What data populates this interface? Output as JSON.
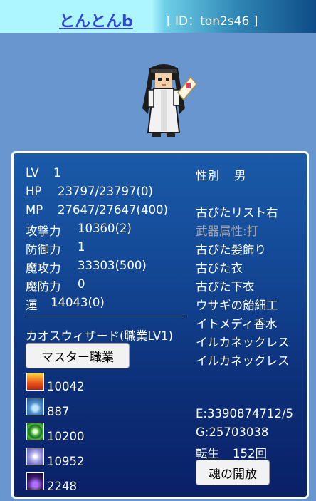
{
  "header": {
    "player_name": "とんとんb",
    "player_id": "[ ID：ton2s46 ]"
  },
  "stats": [
    {
      "label": "LV",
      "value": "1"
    },
    {
      "label": "HP",
      "value": "23797/23797(0)"
    },
    {
      "label": "MP",
      "value": "27647/27647(400)"
    },
    {
      "label": "攻撃力",
      "value": "10360(2)"
    },
    {
      "label": "防御力",
      "value": "1"
    },
    {
      "label": "魔攻力",
      "value": "33303(500)"
    },
    {
      "label": "魔防力",
      "value": "0"
    },
    {
      "label": "運",
      "value": "14043(0)"
    }
  ],
  "profile": {
    "gender_label": "性別",
    "gender_value": "男"
  },
  "equipment": [
    "古びたリスト右",
    "武器属性:打",
    "古びた髪飾り",
    "古びた衣",
    "古びた下衣",
    "ウサギの飴細工",
    "イトメディ香水",
    "イルカネックレス",
    "イルカネックレス"
  ],
  "job": {
    "title": "カオスウィザード(職業LV1)",
    "master_button": "マスター職業"
  },
  "elements": [
    {
      "icon": "fire-element-icon",
      "value": "10042",
      "color": "#e8521a"
    },
    {
      "icon": "water-element-icon",
      "value": "887",
      "color": "#4f8fd0"
    },
    {
      "icon": "wind-element-icon",
      "value": "10200",
      "color": "#4cb83a"
    },
    {
      "icon": "light-element-icon",
      "value": "10952",
      "color": "#8a86d8"
    },
    {
      "icon": "dark-element-icon",
      "value": "2248",
      "color": "#3a1a6a"
    }
  ],
  "summary": {
    "experience": "E:3390874712/5",
    "gold": "G:25703038",
    "rebirth_label": "転生",
    "rebirth_value": "152回",
    "soul_button": "魂の開放"
  }
}
